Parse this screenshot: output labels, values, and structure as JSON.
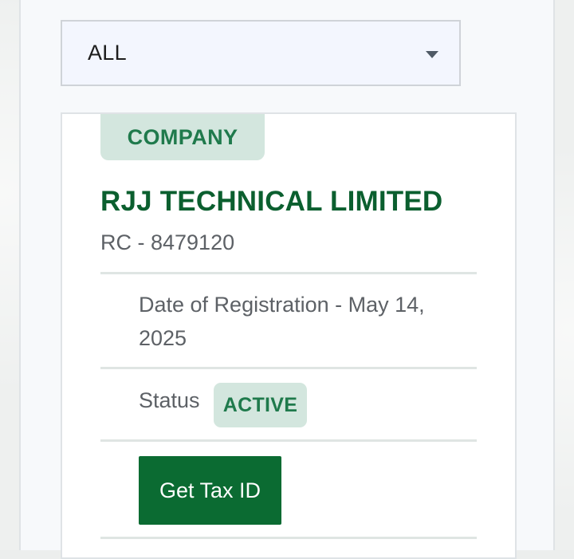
{
  "filter": {
    "selected": "ALL"
  },
  "company": {
    "type_badge": "COMPANY",
    "name": "RJJ TECHNICAL LIMITED",
    "rc_number": "RC - 8479120",
    "registration": "Date of Registration -  May 14, 2025",
    "status_label": "Status",
    "status_value": "ACTIVE",
    "action_label": "Get Tax ID"
  },
  "colors": {
    "brand_green": "#0b6b32",
    "badge_bg": "#d3e6de",
    "badge_text": "#1f7a4c"
  }
}
